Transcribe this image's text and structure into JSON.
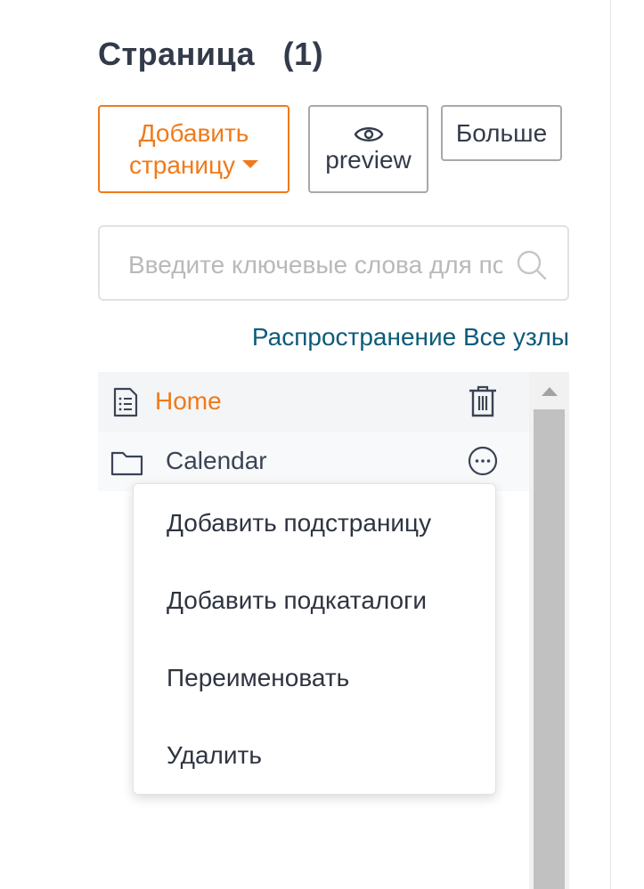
{
  "header": {
    "title": "Страница",
    "count": "(1)"
  },
  "toolbar": {
    "add_line1": "Добавить",
    "add_line2": "страницу",
    "preview_label": "preview",
    "more_label": "Больше"
  },
  "search": {
    "placeholder": "Введите ключевые слова для поиска",
    "value": ""
  },
  "spread_link": "Распространение Все узлы",
  "tree": {
    "items": [
      {
        "label": "Home",
        "icon": "page-icon",
        "action_icon": "trash-icon",
        "state": "active"
      },
      {
        "label": "Calendar",
        "icon": "folder-icon",
        "action_icon": "more-icon",
        "state": "hover"
      }
    ]
  },
  "context_menu": {
    "items": [
      {
        "label": "Добавить подстраницу"
      },
      {
        "label": "Добавить подкаталоги"
      },
      {
        "label": "Переименовать"
      },
      {
        "label": "Удалить"
      }
    ]
  },
  "colors": {
    "accent": "#f07a1a",
    "link": "#0c5b79",
    "text": "#333b4a"
  }
}
